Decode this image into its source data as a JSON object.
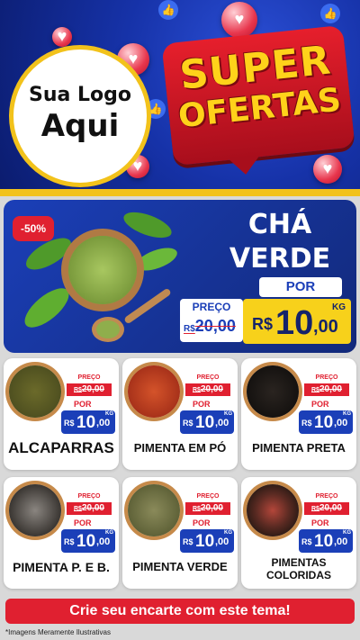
{
  "header": {
    "logo_line1": "Sua Logo",
    "logo_line2": "Aqui",
    "badge_line1": "SUPER",
    "badge_line2": "OFERTAS"
  },
  "hero": {
    "discount": "-50%",
    "title_line1": "CHÁ",
    "title_line2": "VERDE",
    "por_label": "POR",
    "preco_label": "PREÇO",
    "old_currency": "R$",
    "old_price": "20,00",
    "new_currency": "R$",
    "new_int": "10",
    "new_cents": ",00",
    "unit": "KG",
    "image": "green-tea-powder-bowl"
  },
  "products": [
    {
      "name": "ALCAPARRAS",
      "preco_label": "PREÇO",
      "old_currency": "R$",
      "old_price": "20,00",
      "por_label": "POR",
      "new_currency": "R$",
      "new_int": "10",
      "new_cents": ",00",
      "unit": "KG",
      "image": "capers-bowl"
    },
    {
      "name": "PIMENTA EM PÓ",
      "preco_label": "PREÇO",
      "old_currency": "R$",
      "old_price": "20,00",
      "por_label": "POR",
      "new_currency": "R$",
      "new_int": "10",
      "new_cents": ",00",
      "unit": "KG",
      "image": "red-pepper-powder-bowl"
    },
    {
      "name": "PIMENTA PRETA",
      "preco_label": "PREÇO",
      "old_currency": "R$",
      "old_price": "20,00",
      "por_label": "POR",
      "new_currency": "R$",
      "new_int": "10",
      "new_cents": ",00",
      "unit": "KG",
      "image": "black-pepper-bowl"
    },
    {
      "name": "PIMENTA P. E B.",
      "preco_label": "PREÇO",
      "old_currency": "R$",
      "old_price": "20,00",
      "por_label": "POR",
      "new_currency": "R$",
      "new_int": "10",
      "new_cents": ",00",
      "unit": "KG",
      "image": "black-white-pepper-bowl"
    },
    {
      "name": "PIMENTA VERDE",
      "preco_label": "PREÇO",
      "old_currency": "R$",
      "old_price": "20,00",
      "por_label": "POR",
      "new_currency": "R$",
      "new_int": "10",
      "new_cents": ",00",
      "unit": "KG",
      "image": "green-pepper-bowl"
    },
    {
      "name_line1": "PIMENTAS",
      "name_line2": "COLORIDAS",
      "preco_label": "PREÇO",
      "old_currency": "R$",
      "old_price": "20,00",
      "por_label": "POR",
      "new_currency": "R$",
      "new_int": "10",
      "new_cents": ",00",
      "unit": "KG",
      "image": "colored-peppercorns-bowl"
    }
  ],
  "footer": {
    "cta": "Crie seu encarte com este tema!",
    "note": "*Imagens Meramente Ilustrativas"
  },
  "colors": {
    "header_blue": "#1632a8",
    "accent_yellow": "#f2c21b",
    "accent_red": "#e02030",
    "price_blue": "#1b3fb8"
  }
}
